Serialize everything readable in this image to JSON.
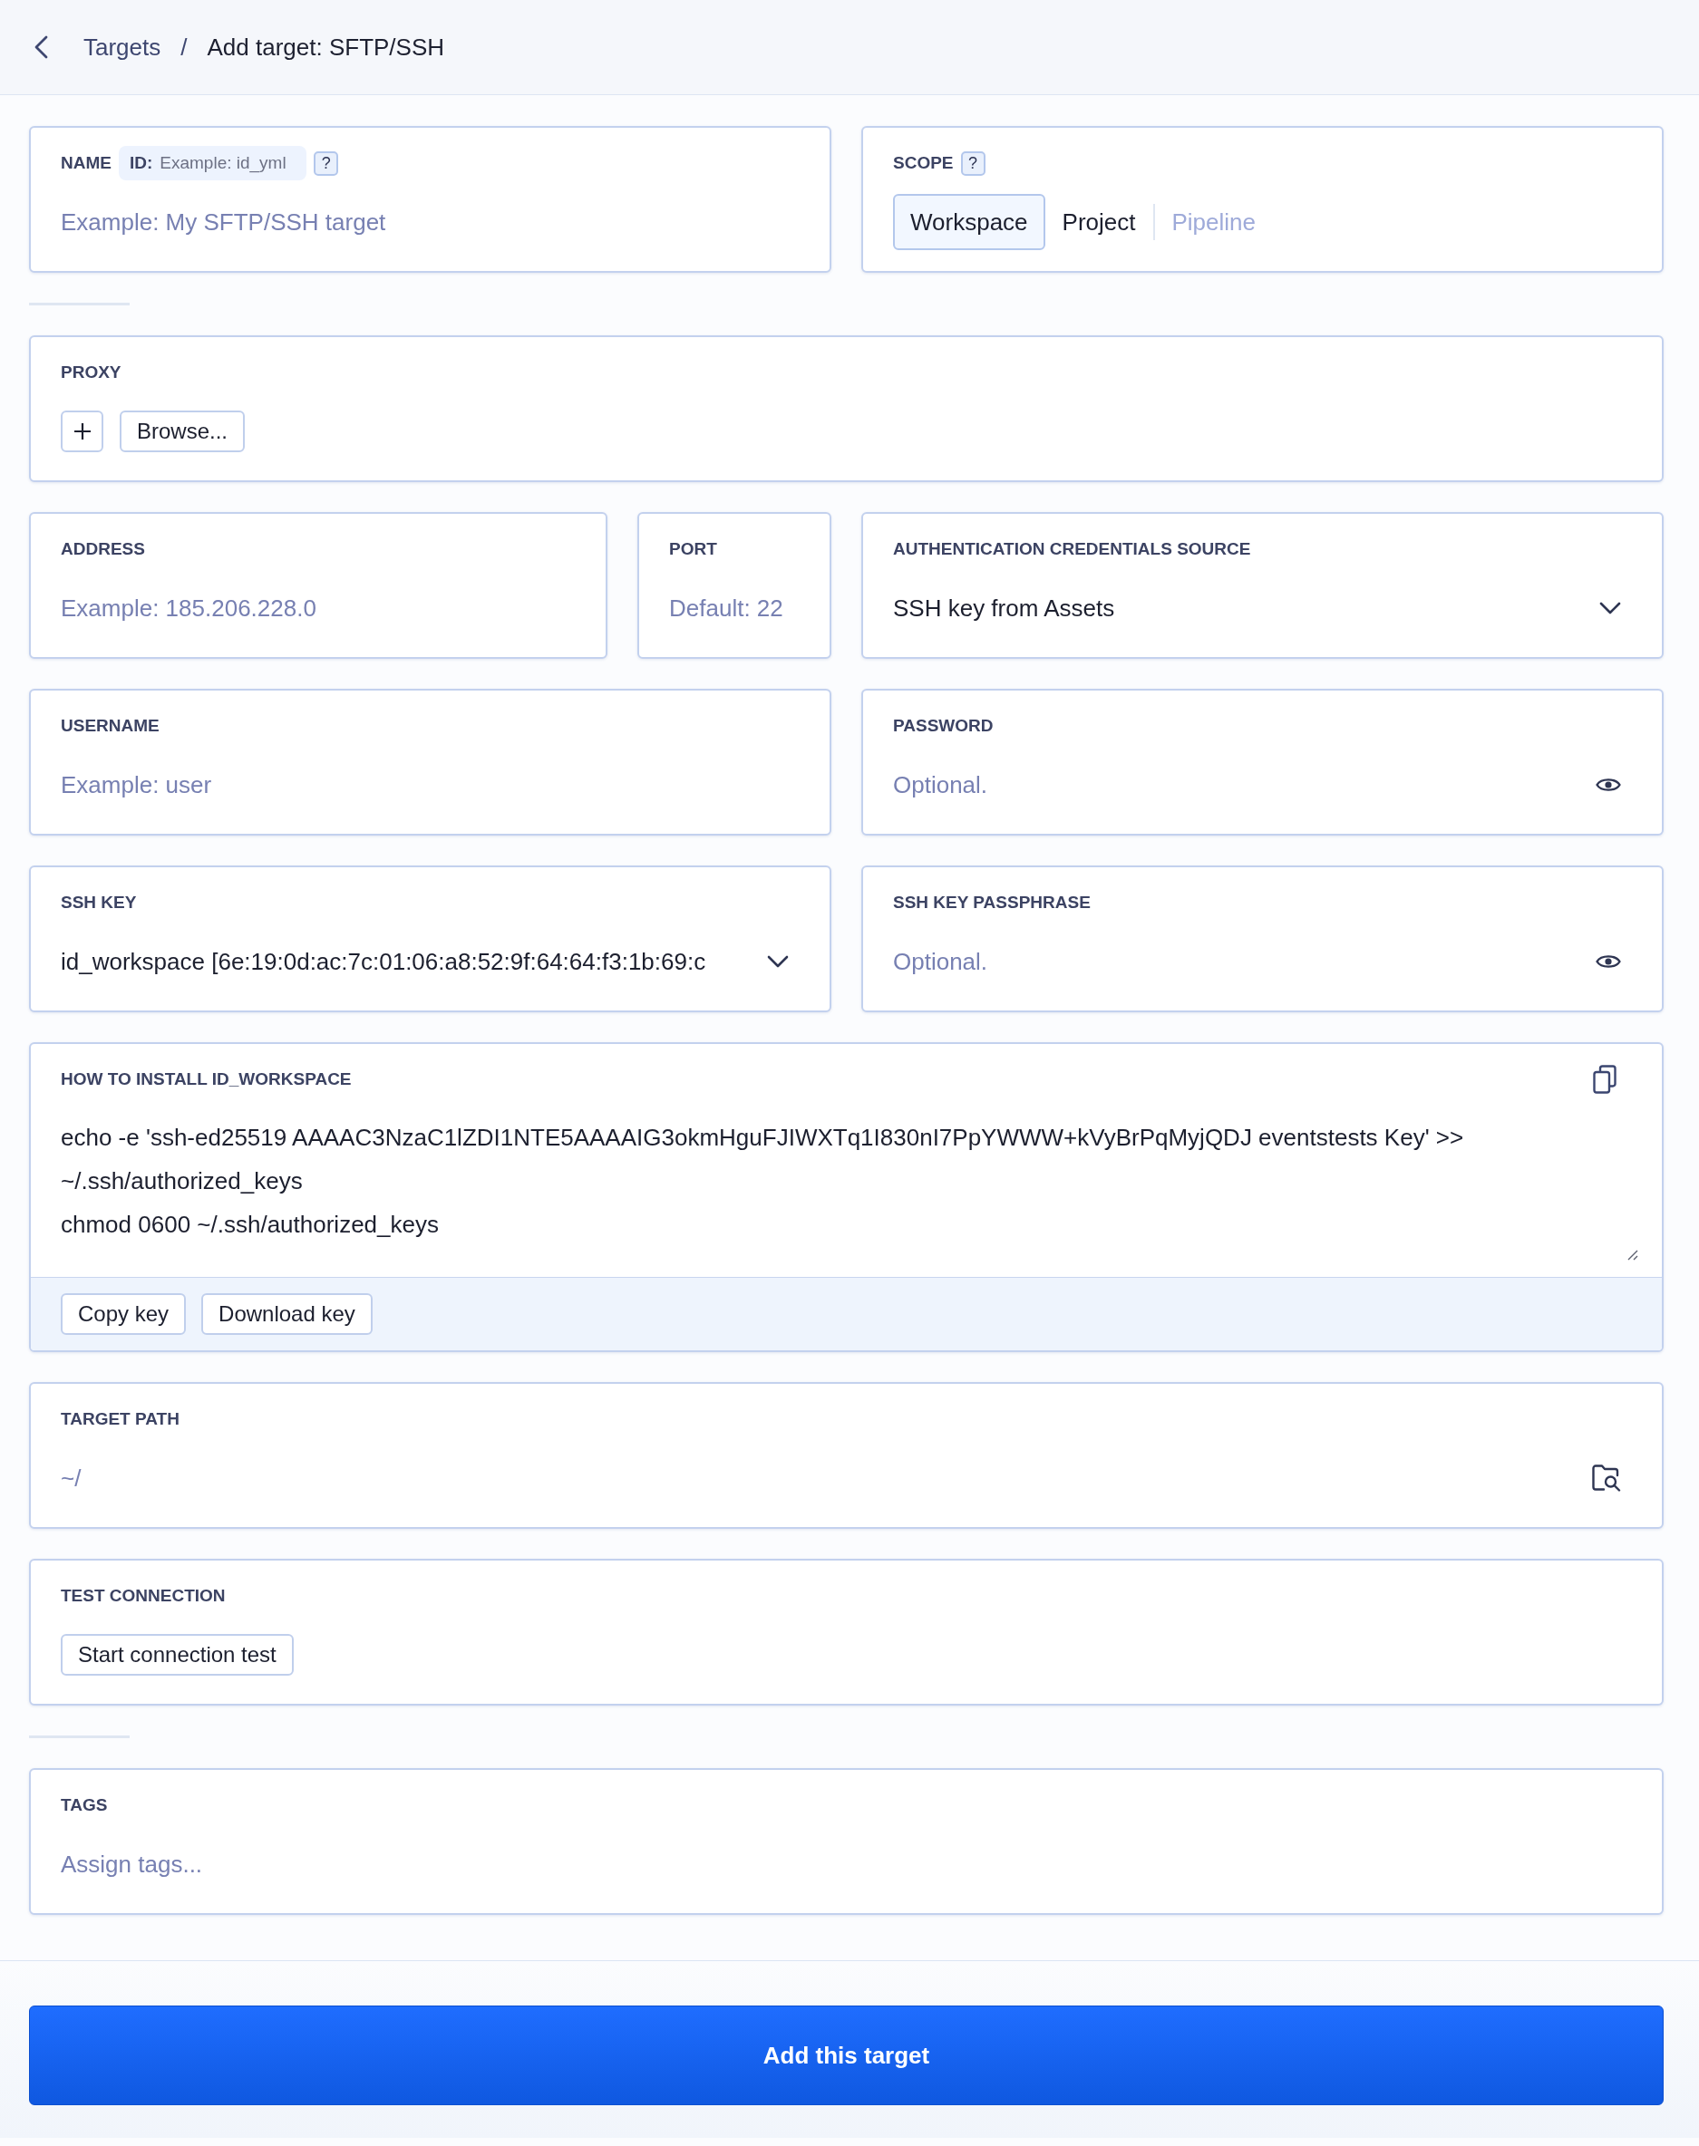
{
  "breadcrumb": {
    "parent": "Targets",
    "separator": "/",
    "current": "Add target: SFTP/SSH"
  },
  "name": {
    "label": "NAME",
    "id_label": "ID:",
    "id_placeholder": "Example: id_yml",
    "help": "?",
    "placeholder": "Example: My SFTP/SSH target"
  },
  "scope": {
    "label": "SCOPE",
    "help": "?",
    "options": [
      {
        "label": "Workspace",
        "selected": true,
        "disabled": false
      },
      {
        "label": "Project",
        "selected": false,
        "disabled": false
      },
      {
        "label": "Pipeline",
        "selected": false,
        "disabled": true
      }
    ]
  },
  "proxy": {
    "label": "PROXY",
    "browse_button": "Browse..."
  },
  "field_rows": [
    [
      {
        "kind": "input",
        "label": "ADDRESS",
        "placeholder": "Example: 185.206.228.0"
      },
      {
        "kind": "input",
        "label": "PORT",
        "placeholder": "Default: 22"
      },
      {
        "kind": "select",
        "label": "AUTHENTICATION CREDENTIALS SOURCE",
        "value": "SSH key from Assets"
      }
    ],
    [
      {
        "kind": "input",
        "label": "USERNAME",
        "placeholder": "Example: user"
      },
      {
        "kind": "password",
        "label": "PASSWORD",
        "placeholder": "Optional."
      }
    ],
    [
      {
        "kind": "select",
        "label": "SSH KEY",
        "value": "id_workspace [6e:19:0d:ac:7c:01:06:a8:52:9f:64:64:f3:1b:69:c"
      },
      {
        "kind": "password",
        "label": "SSH KEY PASSPHRASE",
        "placeholder": "Optional."
      }
    ]
  ],
  "install": {
    "label": "HOW TO INSTALL ID_WORKSPACE",
    "script": "echo -e 'ssh-ed25519 AAAAC3NzaC1lZDI1NTE5AAAAIG3okmHguFJIWXTq1I830nI7PpYWWW+kVyBrPqMyjQDJ eventstests Key' >>\n~/.ssh/authorized_keys\nchmod 0600 ~/.ssh/authorized_keys",
    "buttons": [
      "Copy key",
      "Download key"
    ]
  },
  "target_path": {
    "label": "TARGET PATH",
    "placeholder": "~/"
  },
  "test_connection": {
    "label": "TEST CONNECTION",
    "button": "Start connection test"
  },
  "tags": {
    "label": "TAGS",
    "placeholder": "Assign tags..."
  },
  "submit_button": "Add this target"
}
